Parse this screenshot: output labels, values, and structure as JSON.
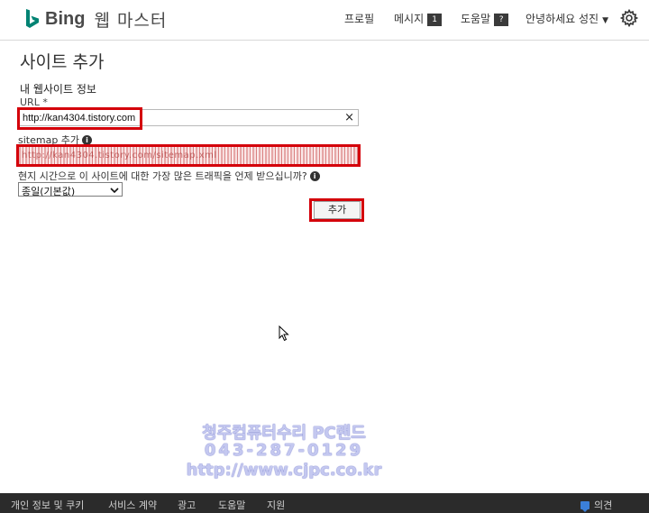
{
  "header": {
    "brand": "Bing",
    "product": "웹 마스터",
    "nav": {
      "profile": "프로필",
      "messages": "메시지",
      "messages_count": "1",
      "help": "도움말",
      "help_badge": "?",
      "user_greeting": "안녕하세요 성진"
    },
    "colors": {
      "brand_accent": "#008373",
      "highlight_red": "#d4000a"
    }
  },
  "main": {
    "title": "사이트 추가",
    "section_label": "내 웹사이트 정보",
    "url_label": "URL *",
    "url_value": "http://kan4304.tistory.com",
    "sitemap_label": "sitemap 추가",
    "sitemap_value": "http://kan4304.tistory.com/sitemap.xml",
    "traffic_question": "현지 시간으로 이 사이트에 대한 가장 많은 트래픽을 언제 받으십니까?",
    "traffic_select_value": "종일(기본값)",
    "add_button": "추가"
  },
  "watermark": {
    "line1": "청주컴퓨터수리 PC랜드",
    "line2": "043-287-0129",
    "line3": "http://www.cjpc.co.kr"
  },
  "footer": {
    "links": [
      "개인 정보 및 쿠키",
      "서비스 계약",
      "광고",
      "도움말",
      "지원"
    ],
    "feedback": "의견"
  }
}
